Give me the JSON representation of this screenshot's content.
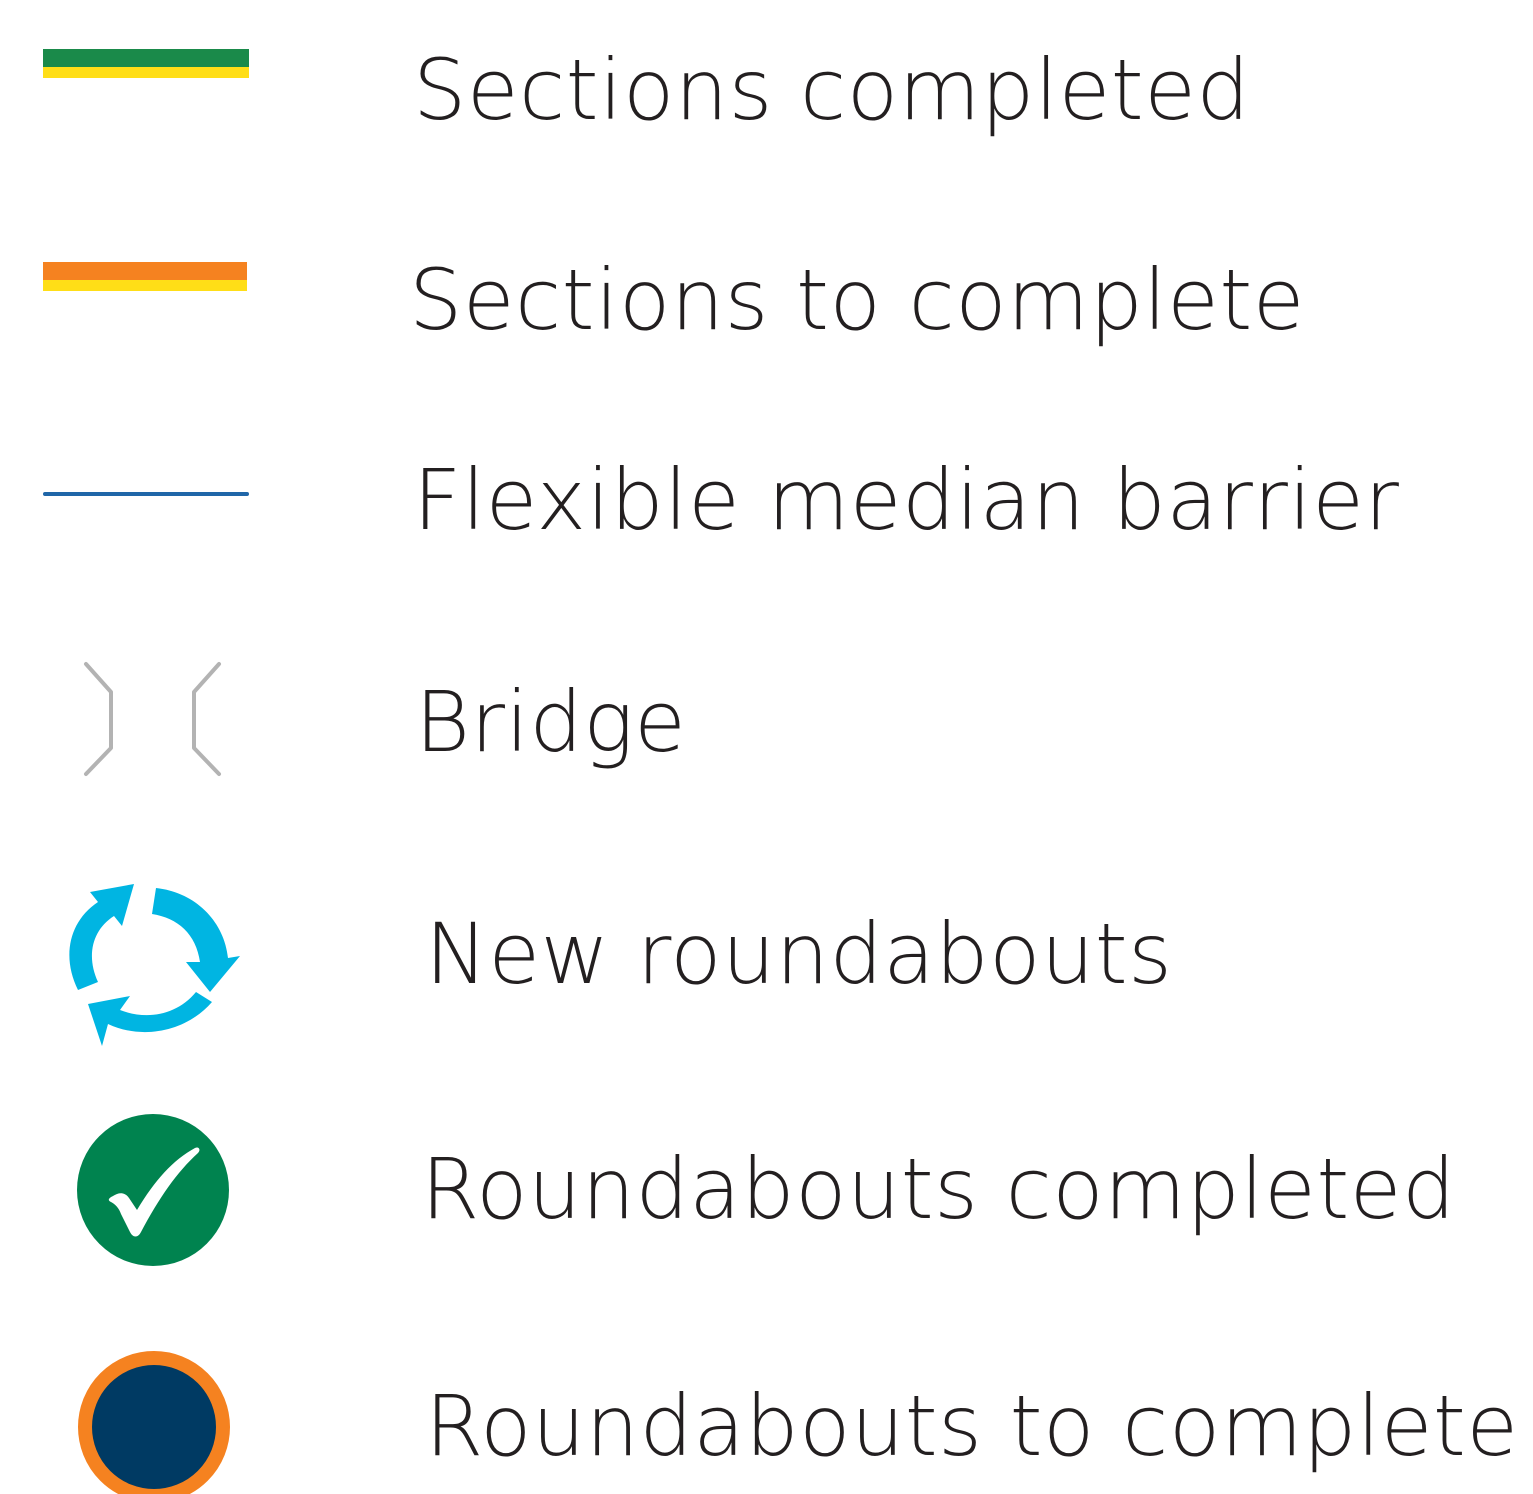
{
  "legend": {
    "items": [
      {
        "label": "Sections completed",
        "icon": "green-yellow-line-icon",
        "colors": [
          "#1a8a4a",
          "#ffde17"
        ]
      },
      {
        "label": "Sections to complete",
        "icon": "orange-yellow-line-icon",
        "colors": [
          "#f58220",
          "#ffde17"
        ]
      },
      {
        "label": "Flexible median barrier",
        "icon": "blue-line-icon",
        "colors": [
          "#2066a8"
        ]
      },
      {
        "label": "Bridge",
        "icon": "bridge-icon",
        "colors": [
          "#b3b3b3"
        ]
      },
      {
        "label": "New roundabouts",
        "icon": "circular-arrows-icon",
        "colors": [
          "#00b5e2"
        ]
      },
      {
        "label": "Roundabouts completed",
        "icon": "checkmark-circle-icon",
        "colors": [
          "#00834f",
          "#ffffff"
        ]
      },
      {
        "label": "Roundabouts to complete",
        "icon": "navy-orange-circle-icon",
        "colors": [
          "#003a63",
          "#f58220"
        ]
      }
    ]
  }
}
